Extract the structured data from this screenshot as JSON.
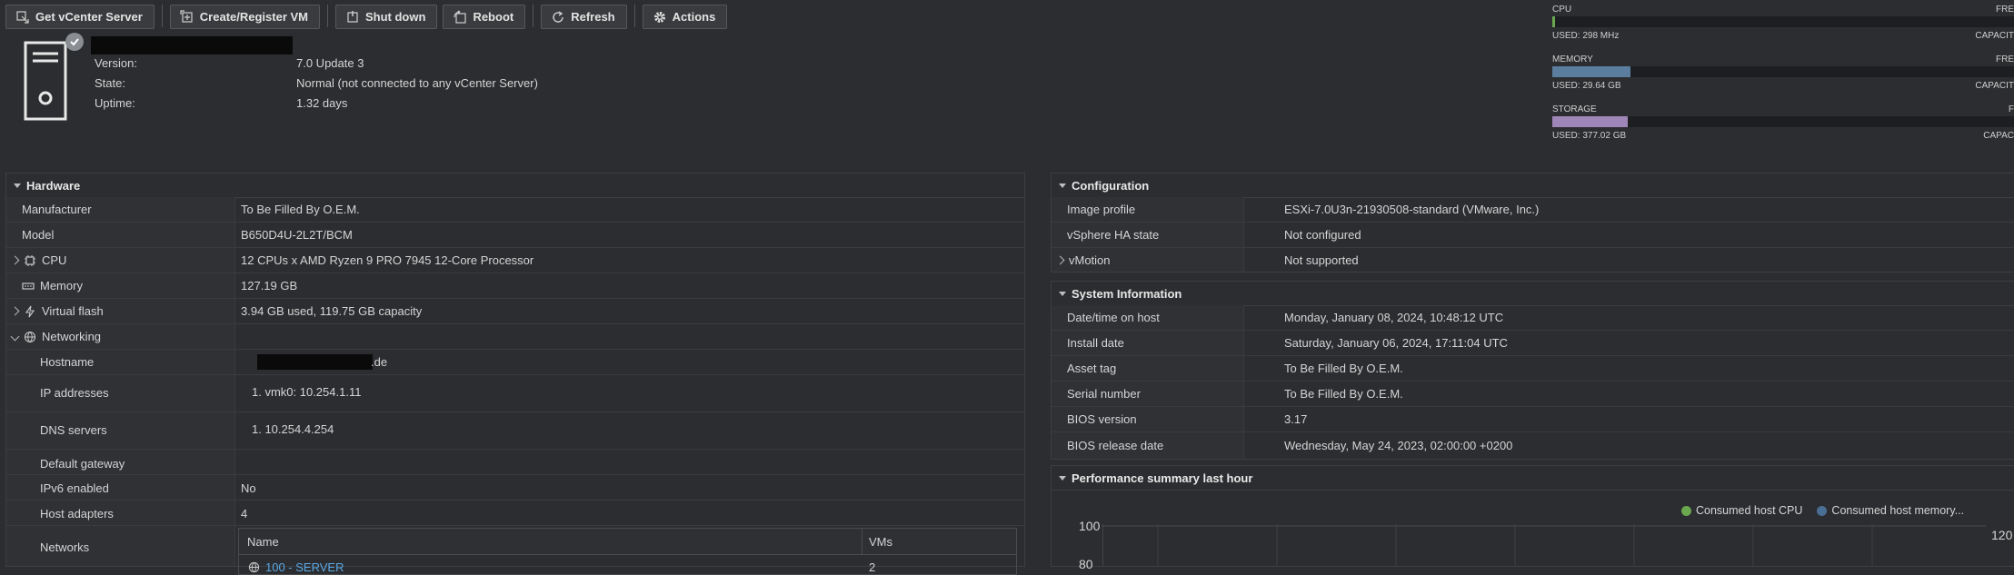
{
  "toolbar": {
    "get_vcenter": "Get vCenter Server",
    "create_vm": "Create/Register VM",
    "shutdown": "Shut down",
    "reboot": "Reboot",
    "refresh": "Refresh",
    "actions": "Actions"
  },
  "summary": {
    "version_label": "Version:",
    "version_value": "7.0 Update 3",
    "state_label": "State:",
    "state_value": "Normal (not connected to any vCenter Server)",
    "uptime_label": "Uptime:",
    "uptime_value": "1.32 days"
  },
  "resources": {
    "cpu": {
      "name": "CPU",
      "free_label": "FRE",
      "used": "USED: 298 MHz",
      "capacity_label": "CAPACIT",
      "used_fraction": 0.006,
      "color": "#6aa84f"
    },
    "memory": {
      "name": "MEMORY",
      "free_label": "FRE",
      "used": "USED: 29.64 GB",
      "capacity_label": "CAPACIT",
      "used_fraction": 0.17,
      "color": "#5b7e9f"
    },
    "storage": {
      "name": "STORAGE",
      "free_label": "F",
      "used": "USED: 377.02 GB",
      "capacity_label": "CAPAC",
      "used_fraction": 0.163,
      "color": "#9f86b8"
    }
  },
  "hardware": {
    "title": "Hardware",
    "manufacturer_label": "Manufacturer",
    "manufacturer_value": "To Be Filled By O.E.M.",
    "model_label": "Model",
    "model_value": "B650D4U-2L2T/BCM",
    "cpu_label": "CPU",
    "cpu_value": "12 CPUs x AMD Ryzen 9 PRO 7945 12-Core Processor",
    "memory_label": "Memory",
    "memory_value": "127.19 GB",
    "vflash_label": "Virtual flash",
    "vflash_value": "3.94 GB used, 119.75 GB capacity",
    "networking_label": "Networking",
    "hostname_label": "Hostname",
    "hostname_value_suffix": ".de",
    "ip_label": "IP addresses",
    "ip_value": "1. vmk0: 10.254.1.11",
    "dns_label": "DNS servers",
    "dns_value": "1. 10.254.4.254",
    "gateway_label": "Default gateway",
    "ipv6_label": "IPv6 enabled",
    "ipv6_value": "No",
    "adapters_label": "Host adapters",
    "adapters_value": "4",
    "networks_label": "Networks",
    "networks_table": {
      "col_name": "Name",
      "col_vms": "VMs",
      "rows": [
        {
          "name": "100 - SERVER",
          "vms": "2"
        }
      ]
    }
  },
  "configuration": {
    "title": "Configuration",
    "image_profile_label": "Image profile",
    "image_profile_value": "ESXi-7.0U3n-21930508-standard (VMware, Inc.)",
    "ha_label": "vSphere HA state",
    "ha_value": "Not configured",
    "vmotion_label": "vMotion",
    "vmotion_value": "Not supported"
  },
  "system_info": {
    "title": "System Information",
    "datetime_label": "Date/time on host",
    "datetime_value": "Monday, January 08, 2024, 10:48:12 UTC",
    "install_label": "Install date",
    "install_value": "Saturday, January 06, 2024, 17:11:04 UTC",
    "asset_label": "Asset tag",
    "asset_value": "To Be Filled By O.E.M.",
    "serial_label": "Serial number",
    "serial_value": "To Be Filled By O.E.M.",
    "bios_version_label": "BIOS version",
    "bios_version_value": "3.17",
    "bios_date_label": "BIOS release date",
    "bios_date_value": "Wednesday, May 24, 2023, 02:00:00 +0200"
  },
  "performance": {
    "title": "Performance summary last hour",
    "legend_cpu": "Consumed host CPU",
    "legend_mem": "Consumed host memory...",
    "cpu_color": "#6aa84f",
    "mem_color": "#4a6f94",
    "y_left_top": "100",
    "y_left_next": "80",
    "y_right_top": "120"
  }
}
